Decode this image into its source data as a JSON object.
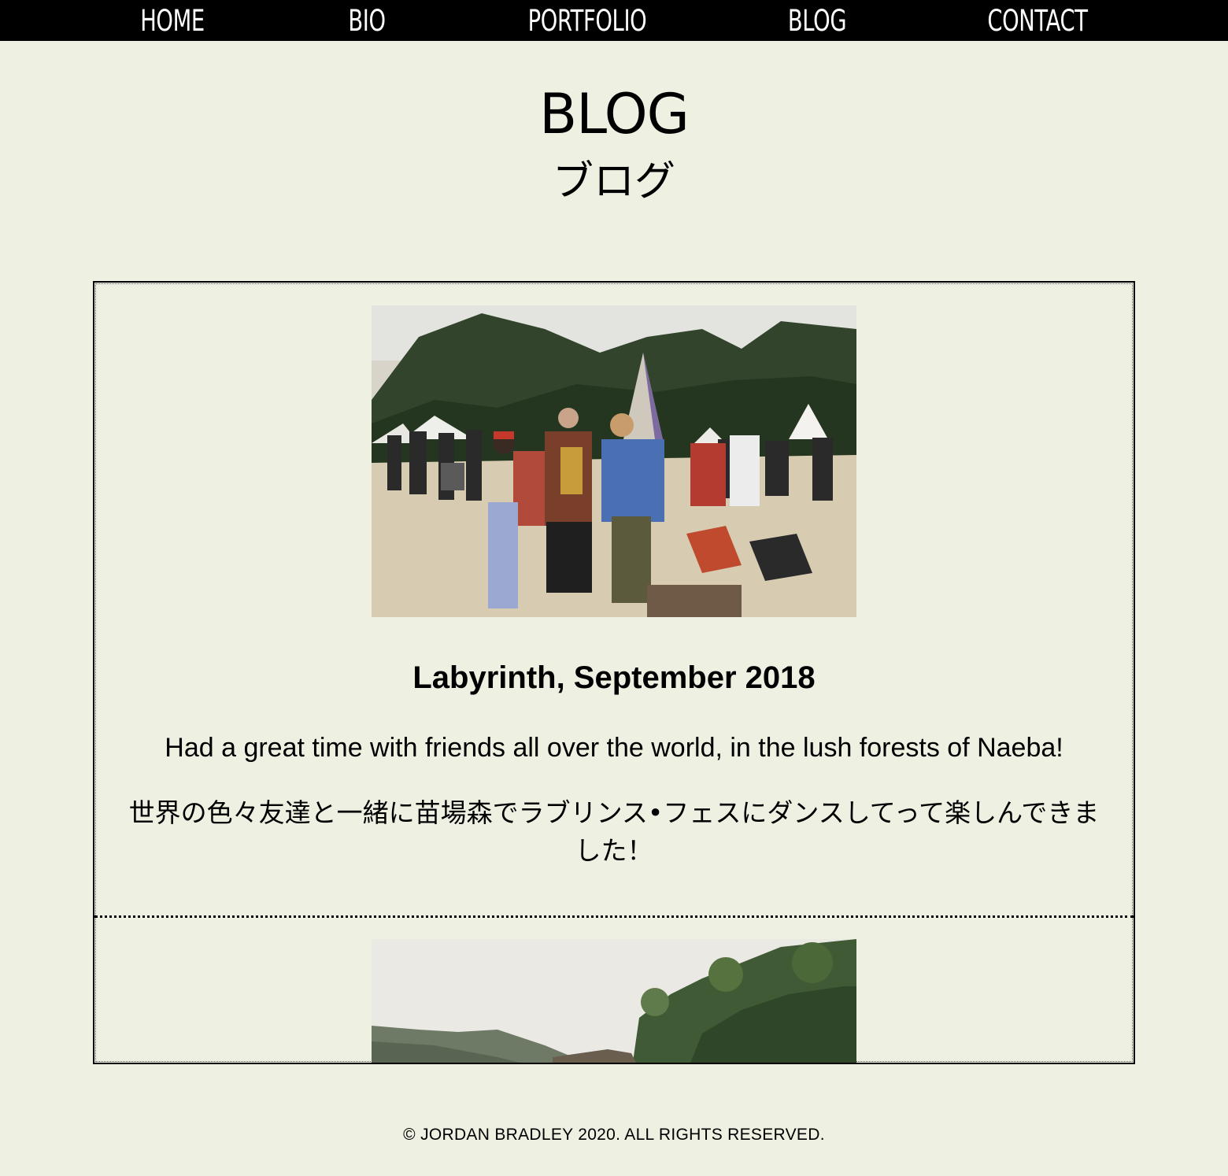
{
  "nav": {
    "items": [
      {
        "label": "HOME"
      },
      {
        "label": "BIO"
      },
      {
        "label": "PORTFOLIO"
      },
      {
        "label": "BLOG"
      },
      {
        "label": "CONTACT"
      }
    ]
  },
  "header": {
    "title": "BLOG",
    "subtitle": "ブログ"
  },
  "posts": [
    {
      "title": "Labyrinth, September 2018",
      "text_en": "Had a great time with friends all over the world, in the lush forests of Naeba!",
      "text_ja": "世界の色々友達と一緒に苗場森でラブリンス•フェスにダンスしてって楽しんできました！"
    },
    {
      "title": "",
      "text_en": "",
      "text_ja": ""
    }
  ],
  "footer": {
    "copyright": "© JORDAN BRADLEY 2020. ALL RIGHTS RESERVED."
  }
}
